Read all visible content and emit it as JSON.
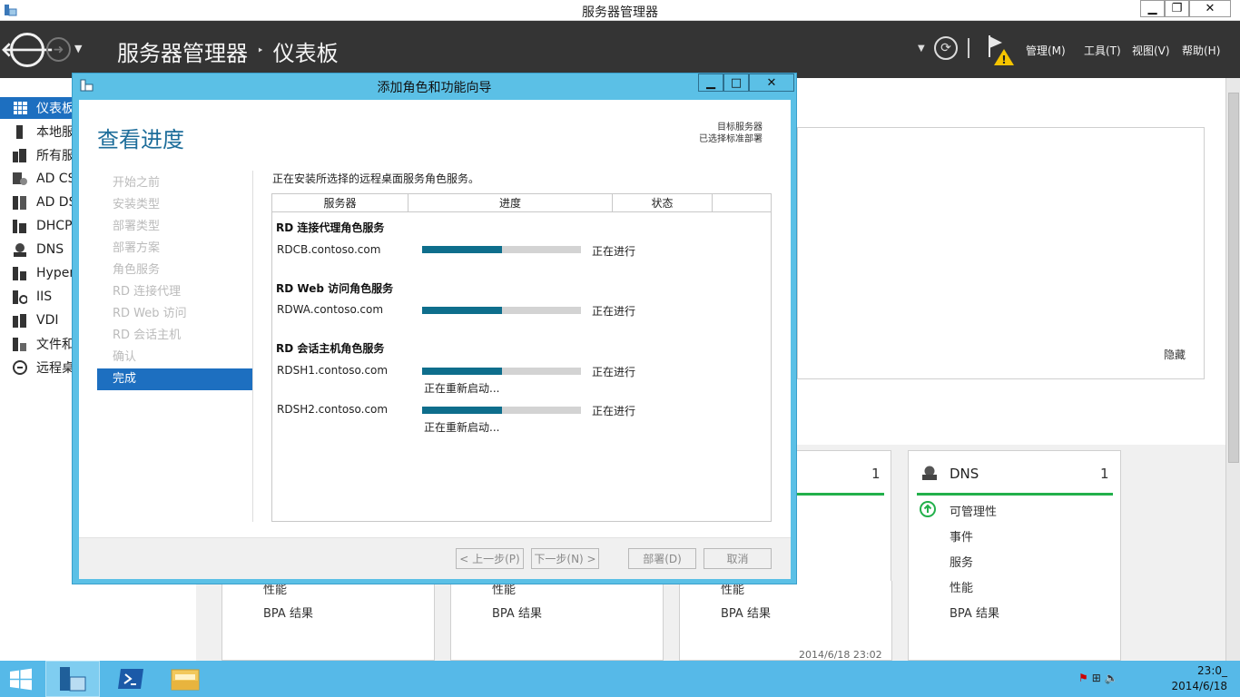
{
  "window": {
    "title": "服务器管理器",
    "minimize_glyph": "▁",
    "restore_glyph": "❐",
    "close_glyph": "✕"
  },
  "header": {
    "breadcrumb_root": "服务器管理器",
    "breadcrumb_sep": "‣",
    "breadcrumb_current": "仪表板",
    "menus": [
      "管理(M)",
      "工具(T)",
      "视图(V)",
      "帮助(H)"
    ]
  },
  "leftnav": {
    "items": [
      {
        "label": "仪表板",
        "icon": "dashboard-icon"
      },
      {
        "label": "本地服务器",
        "icon": "server-icon"
      },
      {
        "label": "所有服务器",
        "icon": "servers-icon"
      },
      {
        "label": "AD CS",
        "icon": "ad-cs-icon"
      },
      {
        "label": "AD DS",
        "icon": "ad-ds-icon"
      },
      {
        "label": "DHCP",
        "icon": "dhcp-icon"
      },
      {
        "label": "DNS",
        "icon": "dns-icon"
      },
      {
        "label": "Hyper-V",
        "icon": "hyperv-icon"
      },
      {
        "label": "IIS",
        "icon": "iis-icon"
      },
      {
        "label": "VDI",
        "icon": "vdi-icon"
      },
      {
        "label": "文件和存储服务",
        "icon": "file-storage-icon"
      },
      {
        "label": "远程桌面服务",
        "icon": "remote-desktop-icon"
      }
    ]
  },
  "background": {
    "hide_label": "隐藏",
    "tile_count_a": "1",
    "dns_tile": {
      "title": "DNS",
      "count": "1",
      "items": [
        "可管理性",
        "事件",
        "服务",
        "性能",
        "BPA 结果"
      ]
    },
    "lower_labels": [
      "性能",
      "BPA 结果"
    ],
    "timestamp": "2014/6/18 23:02"
  },
  "wizard": {
    "title": "添加角色和功能向导",
    "heading": "查看进度",
    "dest_label": "目标服务器",
    "dest_value": "已选择标准部署",
    "steps": [
      "开始之前",
      "安装类型",
      "部署类型",
      "部署方案",
      "角色服务",
      "RD 连接代理",
      "RD Web 访问",
      "RD 会话主机",
      "确认",
      "完成"
    ],
    "active_step": 9,
    "intro": "正在安装所选择的远程桌面服务角色服务。",
    "columns": [
      "服务器",
      "进度",
      "状态"
    ],
    "groups": [
      {
        "name": "RD 连接代理角色服务",
        "servers": [
          {
            "name": "RDCB.contoso.com",
            "progress": 0.5,
            "status": "正在进行",
            "sub": ""
          }
        ]
      },
      {
        "name": "RD Web 访问角色服务",
        "servers": [
          {
            "name": "RDWA.contoso.com",
            "progress": 0.5,
            "status": "正在进行",
            "sub": ""
          }
        ]
      },
      {
        "name": "RD 会话主机角色服务",
        "servers": [
          {
            "name": "RDSH1.contoso.com",
            "progress": 0.5,
            "status": "正在进行",
            "sub": "正在重新启动..."
          },
          {
            "name": "RDSH2.contoso.com",
            "progress": 0.5,
            "status": "正在进行",
            "sub": "正在重新启动..."
          }
        ]
      }
    ],
    "buttons": {
      "prev": "< 上一步(P)",
      "next": "下一步(N) >",
      "deploy": "部署(D)",
      "cancel": "取消"
    }
  },
  "taskbar": {
    "time": "23:0_",
    "date": "2014/6/18"
  },
  "colors": {
    "accent": "#1d6fc0",
    "progress_fill": "#0e6e8c",
    "wizard_frame": "#5bc0e6",
    "taskbar": "#56b9e8",
    "header": "#343434",
    "status_green": "#22b04b"
  }
}
